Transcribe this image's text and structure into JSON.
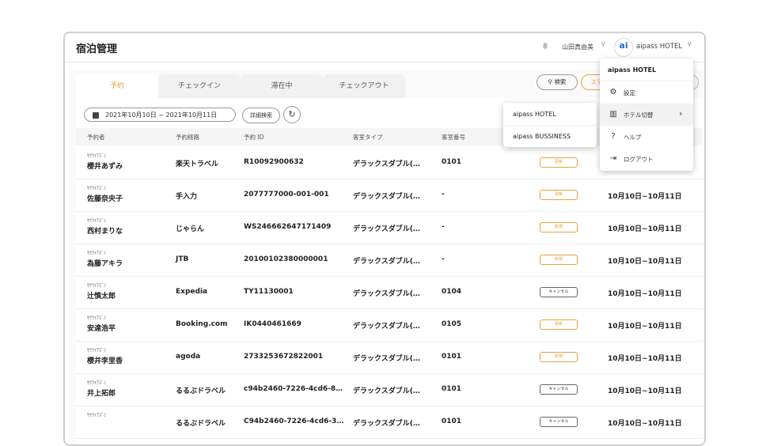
{
  "header": {
    "title": "宿泊管理",
    "user_name": "山田真由美",
    "logo_text": "ai",
    "hotel_name": "aipass HOTEL"
  },
  "tabs": [
    {
      "label": "予約"
    },
    {
      "label": "チェックイン"
    },
    {
      "label": "滞在中"
    },
    {
      "label": "チェックアウト"
    }
  ],
  "toolbar": {
    "search_label": "検索",
    "status_label": "ステ",
    "date_range": "2021年10月10日 ~ 2021年10月11日",
    "detail_search_label": "詳細検索"
  },
  "table": {
    "headers": [
      "予約者",
      "予約経路",
      "予約 ID",
      "客室タイプ",
      "客室番号"
    ],
    "rows": [
      {
        "kana": "ｻｸﾗｲｱｽﾞﾐ",
        "name": "櫻井あずみ",
        "route": "楽天トラベル",
        "id": "R10092900632",
        "room_type": "デラックスダブル(…",
        "room_no": "0101",
        "status": "更新",
        "status_style": "orange",
        "stay": ""
      },
      {
        "kana": "ｻｸﾗｲｱｽﾞﾐ",
        "name": "佐藤奈央子",
        "route": "手入力",
        "id": "2077777000-001-001",
        "room_type": "デラックスダブル(…",
        "room_no": "-",
        "status": "更新",
        "status_style": "orange",
        "stay": "10月10日~10月11日"
      },
      {
        "kana": "ｻｸﾗｲｱｽﾞﾐ",
        "name": "西村まりな",
        "route": "じゃらん",
        "id": "WS246662647171409",
        "room_type": "デラックスダブル(…",
        "room_no": "-",
        "status": "新規",
        "status_style": "orange",
        "stay": "10月10日~10月11日"
      },
      {
        "kana": "ｻｸﾗｲｱｽﾞﾐ",
        "name": "為藤アキラ",
        "route": "JTB",
        "id": "20100102380000001",
        "room_type": "デラックスダブル(…",
        "room_no": "-",
        "status": "新規",
        "status_style": "orange",
        "stay": "10月10日~10月11日"
      },
      {
        "kana": "ｻｸﾗｲｱｽﾞﾐ",
        "name": "辻慎太郎",
        "route": "Expedia",
        "id": "TY11130001",
        "room_type": "デラックスダブル(…",
        "room_no": "0104",
        "status": "キャンセル",
        "status_style": "gray",
        "stay": "10月10日~10月11日"
      },
      {
        "kana": "ｻｸﾗｲｱｽﾞﾐ",
        "name": "安達浩平",
        "route": "Booking.com",
        "id": "IK0440461669",
        "room_type": "デラックスダブル(…",
        "room_no": "0105",
        "status": "更新",
        "status_style": "orange",
        "stay": "10月10日~10月11日"
      },
      {
        "kana": "ｻｸﾗｲｱｽﾞﾐ",
        "name": "櫻井李里香",
        "route": "agoda",
        "id": "2733253672822001",
        "room_type": "デラックスダブル(…",
        "room_no": "0101",
        "status": "新規",
        "status_style": "orange",
        "stay": "10月10日~10月11日"
      },
      {
        "kana": "ｻｸﾗｲｱｽﾞﾐ",
        "name": "井上拓郎",
        "route": "るるぶドラベル",
        "id": "c94b2460-7226-4cd6-8…",
        "room_type": "デラックスダブル(…",
        "room_no": "0101",
        "status": "キャンセル",
        "status_style": "gray",
        "stay": "10月10日~10月11日"
      },
      {
        "kana": "ｻｸﾗｲｱｽﾞﾐ",
        "name": "",
        "route": "るるぶドラベル",
        "id": "C94b2460-7226-4cd6-3…",
        "room_type": "デラックスダブル(…",
        "room_no": "0101",
        "status": "キャンセル",
        "status_style": "gray",
        "stay": "10月10日~10月11日"
      }
    ]
  },
  "ota_popup": {
    "items": [
      "aipass HOTEL",
      "aipass BUSSINESS"
    ],
    "hidden_digit": "1"
  },
  "user_menu": {
    "title": "aipass HOTEL",
    "items": [
      {
        "label": "設定",
        "icon": "gear-icon"
      },
      {
        "label": "ホテル切替",
        "icon": "building-icon"
      },
      {
        "label": "ヘルプ",
        "icon": "help-icon"
      },
      {
        "label": "ログアウト",
        "icon": "logout-icon"
      }
    ]
  }
}
